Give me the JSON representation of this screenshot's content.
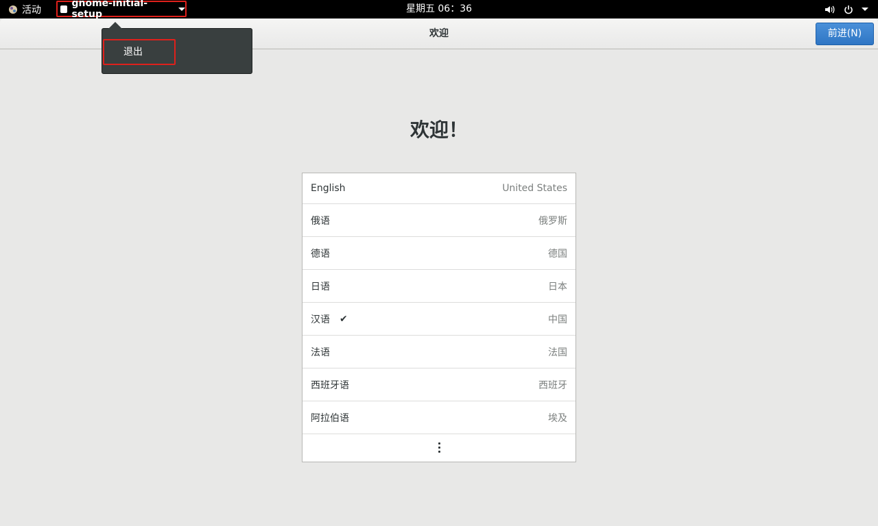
{
  "topbar": {
    "activities_label": "活动",
    "app_menu_label": "gnome-initial-setup",
    "clock": "星期五 06：36",
    "icons": [
      "activities-logo-icon",
      "volume-icon",
      "power-icon",
      "chevron-down-icon"
    ]
  },
  "app_menu_popover": {
    "items": [
      {
        "label": "退出"
      }
    ]
  },
  "headerbar": {
    "title": "欢迎",
    "next_button_label": "前进(N)"
  },
  "main": {
    "heading": "欢迎！",
    "languages": [
      {
        "name": "English",
        "region": "United States",
        "selected": false
      },
      {
        "name": "俄语",
        "region": "俄罗斯",
        "selected": false
      },
      {
        "name": "德语",
        "region": "德国",
        "selected": false
      },
      {
        "name": "日语",
        "region": "日本",
        "selected": false
      },
      {
        "name": "汉语",
        "region": "中国",
        "selected": true,
        "check_mark": "✔"
      },
      {
        "name": "法语",
        "region": "法国",
        "selected": false
      },
      {
        "name": "西班牙语",
        "region": "西班牙",
        "selected": false
      },
      {
        "name": "阿拉伯语",
        "region": "埃及",
        "selected": false
      }
    ],
    "more_icon": "vertical-ellipsis-icon"
  },
  "colors": {
    "topbar_bg": "#000000",
    "background": "#e8e8e7",
    "accent_button": "#3584e4",
    "highlight_border": "#e0201b",
    "popover_bg": "#393f3f"
  }
}
